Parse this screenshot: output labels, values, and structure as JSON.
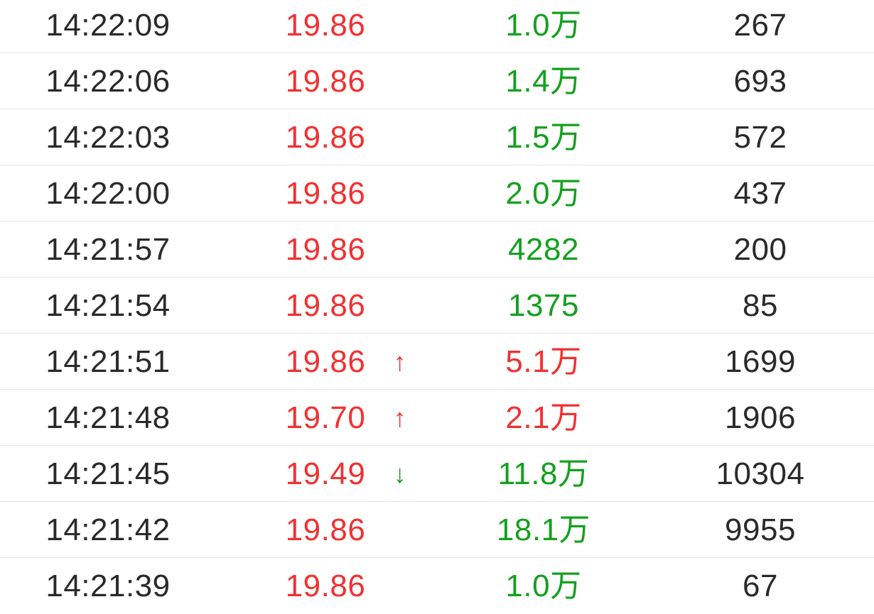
{
  "colors": {
    "up": "#f23030",
    "down": "#14a01e",
    "neutral": "#2a2a2a",
    "divider": "#e6e6e6"
  },
  "rows": [
    {
      "time": "14:22:09",
      "price": "19.86",
      "price_color": "red",
      "arrow": "",
      "arrow_color": "",
      "volume": "1.0万",
      "volume_color": "green",
      "count": "267"
    },
    {
      "time": "14:22:06",
      "price": "19.86",
      "price_color": "red",
      "arrow": "",
      "arrow_color": "",
      "volume": "1.4万",
      "volume_color": "green",
      "count": "693"
    },
    {
      "time": "14:22:03",
      "price": "19.86",
      "price_color": "red",
      "arrow": "",
      "arrow_color": "",
      "volume": "1.5万",
      "volume_color": "green",
      "count": "572"
    },
    {
      "time": "14:22:00",
      "price": "19.86",
      "price_color": "red",
      "arrow": "",
      "arrow_color": "",
      "volume": "2.0万",
      "volume_color": "green",
      "count": "437"
    },
    {
      "time": "14:21:57",
      "price": "19.86",
      "price_color": "red",
      "arrow": "",
      "arrow_color": "",
      "volume": "4282",
      "volume_color": "green",
      "count": "200"
    },
    {
      "time": "14:21:54",
      "price": "19.86",
      "price_color": "red",
      "arrow": "",
      "arrow_color": "",
      "volume": "1375",
      "volume_color": "green",
      "count": "85"
    },
    {
      "time": "14:21:51",
      "price": "19.86",
      "price_color": "red",
      "arrow": "↑",
      "arrow_color": "red",
      "volume": "5.1万",
      "volume_color": "red",
      "count": "1699"
    },
    {
      "time": "14:21:48",
      "price": "19.70",
      "price_color": "red",
      "arrow": "↑",
      "arrow_color": "red",
      "volume": "2.1万",
      "volume_color": "red",
      "count": "1906"
    },
    {
      "time": "14:21:45",
      "price": "19.49",
      "price_color": "red",
      "arrow": "↓",
      "arrow_color": "green",
      "volume": "11.8万",
      "volume_color": "green",
      "count": "10304"
    },
    {
      "time": "14:21:42",
      "price": "19.86",
      "price_color": "red",
      "arrow": "",
      "arrow_color": "",
      "volume": "18.1万",
      "volume_color": "green",
      "count": "9955"
    },
    {
      "time": "14:21:39",
      "price": "19.86",
      "price_color": "red",
      "arrow": "",
      "arrow_color": "",
      "volume": "1.0万",
      "volume_color": "green",
      "count": "67"
    }
  ]
}
